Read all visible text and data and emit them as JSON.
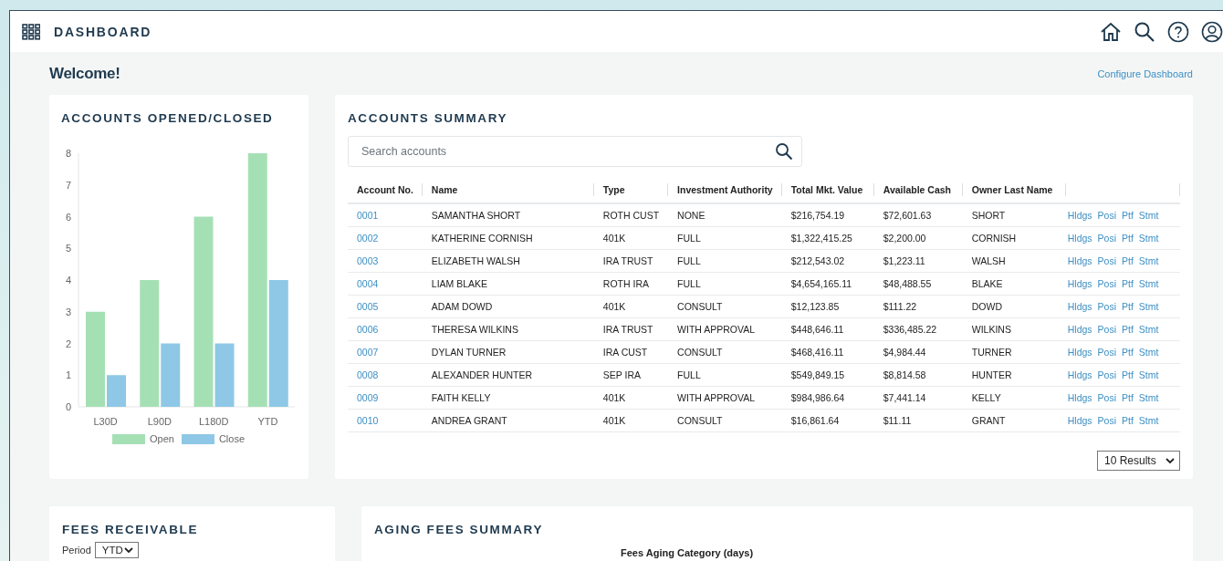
{
  "header": {
    "title": "DASHBOARD"
  },
  "welcome": "Welcome!",
  "configure_link": "Configure Dashboard",
  "accounts_chart": {
    "title": "ACCOUNTS OPENED/CLOSED",
    "chart_data": {
      "type": "bar",
      "categories": [
        "L30D",
        "L90D",
        "L180D",
        "YTD"
      ],
      "series": [
        {
          "name": "Open",
          "color": "#a5e0b5",
          "values": [
            3,
            4,
            6,
            8
          ]
        },
        {
          "name": "Close",
          "color": "#8ec8e6",
          "values": [
            1,
            2,
            2,
            4
          ]
        }
      ],
      "ylim": [
        0,
        8
      ],
      "yticks": [
        0,
        1,
        2,
        3,
        4,
        5,
        6,
        7,
        8
      ]
    }
  },
  "accounts_summary": {
    "title": "ACCOUNTS SUMMARY",
    "search": {
      "placeholder": "Search accounts"
    },
    "columns": [
      "Account No.",
      "Name",
      "Type",
      "Investment Authority",
      "Total Mkt. Value",
      "Available Cash",
      "Owner Last Name"
    ],
    "rows": [
      {
        "account": "0001",
        "name": "SAMANTHA SHORT",
        "type": "ROTH CUST",
        "authority": "NONE",
        "total": "$216,754.19",
        "cash": "$72,601.63",
        "owner": "SHORT",
        "actions": [
          "Hldgs",
          "Posi",
          "Ptf",
          "Stmt"
        ]
      },
      {
        "account": "0002",
        "name": "KATHERINE CORNISH",
        "type": "401K",
        "authority": "FULL",
        "total": "$1,322,415.25",
        "cash": "$2,200.00",
        "owner": "CORNISH",
        "actions": [
          "Hldgs",
          "Posi",
          "Ptf",
          "Stmt"
        ]
      },
      {
        "account": "0003",
        "name": "ELIZABETH WALSH",
        "type": "IRA TRUST",
        "authority": "FULL",
        "total": "$212,543.02",
        "cash": "$1,223.11",
        "owner": "WALSH",
        "actions": [
          "Hldgs",
          "Posi",
          "Ptf",
          "Stmt"
        ]
      },
      {
        "account": "0004",
        "name": "LIAM BLAKE",
        "type": "ROTH IRA",
        "authority": "FULL",
        "total": "$4,654,165.11",
        "cash": "$48,488.55",
        "owner": "BLAKE",
        "actions": [
          "Hldgs",
          "Posi",
          "Ptf",
          "Stmt"
        ]
      },
      {
        "account": "0005",
        "name": "ADAM DOWD",
        "type": "401K",
        "authority": "CONSULT",
        "total": "$12,123.85",
        "cash": "$111.22",
        "owner": "DOWD",
        "actions": [
          "Hldgs",
          "Posi",
          "Ptf",
          "Stmt"
        ]
      },
      {
        "account": "0006",
        "name": "THERESA WILKINS",
        "type": "IRA TRUST",
        "authority": "WITH APPROVAL",
        "total": "$448,646.11",
        "cash": "$336,485.22",
        "owner": "WILKINS",
        "actions": [
          "Hldgs",
          "Posi",
          "Ptf",
          "Stmt"
        ]
      },
      {
        "account": "0007",
        "name": "DYLAN TURNER",
        "type": "IRA CUST",
        "authority": "CONSULT",
        "total": "$468,416.11",
        "cash": "$4,984.44",
        "owner": "TURNER",
        "actions": [
          "Hldgs",
          "Posi",
          "Ptf",
          "Stmt"
        ]
      },
      {
        "account": "0008",
        "name": "ALEXANDER HUNTER",
        "type": "SEP IRA",
        "authority": "FULL",
        "total": "$549,849.15",
        "cash": "$8,814.58",
        "owner": "HUNTER",
        "actions": [
          "Hldgs",
          "Posi",
          "Ptf",
          "Stmt"
        ]
      },
      {
        "account": "0009",
        "name": "FAITH KELLY",
        "type": "401K",
        "authority": "WITH APPROVAL",
        "total": "$984,986.64",
        "cash": "$7,441.14",
        "owner": "KELLY",
        "actions": [
          "Hldgs",
          "Posi",
          "Ptf",
          "Stmt"
        ]
      },
      {
        "account": "0010",
        "name": "ANDREA GRANT",
        "type": "401K",
        "authority": "CONSULT",
        "total": "$16,861.64",
        "cash": "$11.11",
        "owner": "GRANT",
        "actions": [
          "Hldgs",
          "Posi",
          "Ptf",
          "Stmt"
        ]
      }
    ],
    "results_select": {
      "value": "10 Results"
    }
  },
  "fees_receivable": {
    "title": "FEES RECEIVABLE",
    "period_label": "Period",
    "period_select": {
      "value": "YTD"
    }
  },
  "aging_fees": {
    "title": "AGING FEES SUMMARY",
    "legend_title": "Fees Aging Category (days)"
  }
}
